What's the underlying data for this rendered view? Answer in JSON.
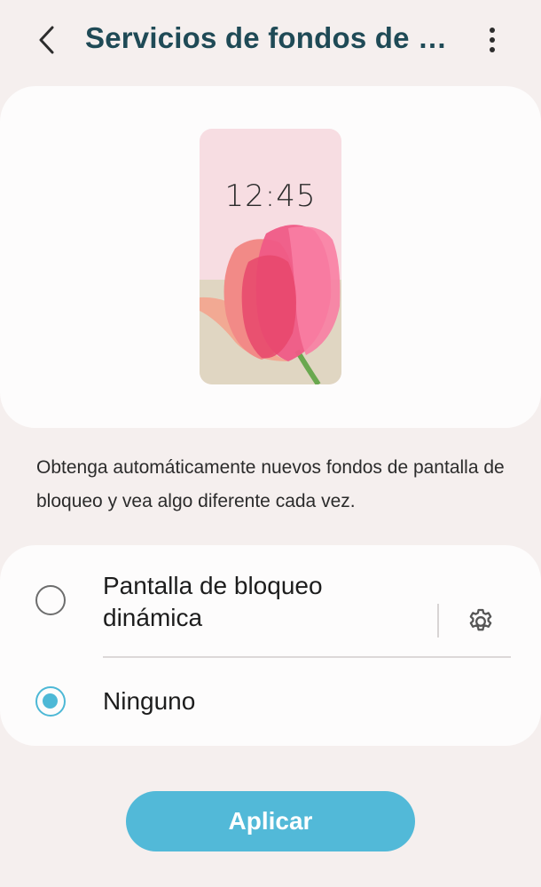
{
  "header": {
    "title": "Servicios de fondos de p..."
  },
  "icons": {
    "back": "chevron-left-icon",
    "more": "more-vertical-icon",
    "settings": "gear-icon"
  },
  "preview": {
    "clock": "12:45"
  },
  "description": "Obtenga automáticamente nuevos fondos de pantalla de bloqueo y vea algo diferente cada vez.",
  "options": [
    {
      "label": "Pantalla de bloqueo dinámica",
      "selected": false
    },
    {
      "label": "Ninguno",
      "selected": true
    }
  ],
  "apply_button": {
    "label": "Aplicar"
  },
  "colors": {
    "accent": "#52b9d8",
    "title": "#1f4a56",
    "background": "#f5efee",
    "card": "#fdfcfc"
  }
}
